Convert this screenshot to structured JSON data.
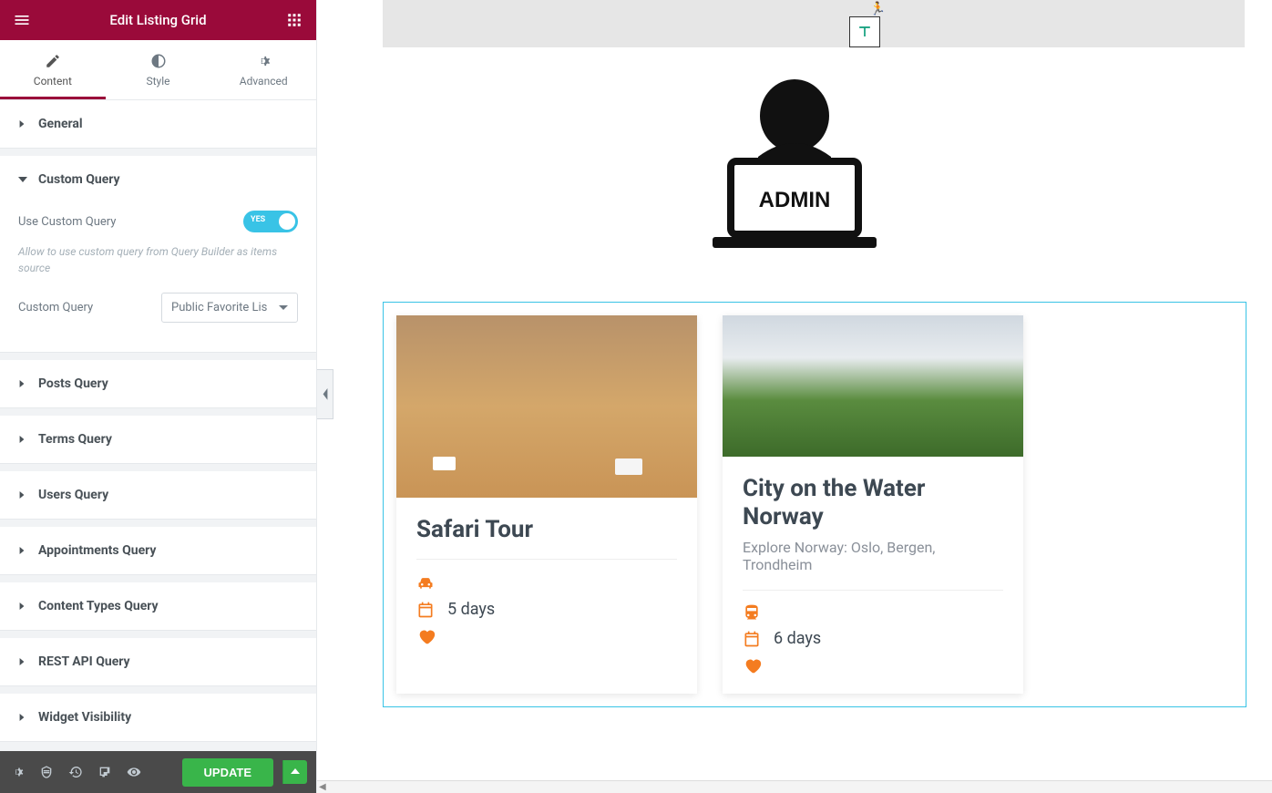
{
  "header": {
    "title": "Edit Listing Grid"
  },
  "tabs": {
    "content": "Content",
    "style": "Style",
    "advanced": "Advanced"
  },
  "sections": {
    "general": "General",
    "custom_query": "Custom Query",
    "posts_query": "Posts Query",
    "terms_query": "Terms Query",
    "users_query": "Users Query",
    "appointments_query": "Appointments Query",
    "content_types_query": "Content Types Query",
    "rest_api_query": "REST API Query",
    "widget_visibility": "Widget Visibility"
  },
  "custom_query": {
    "use_label": "Use Custom Query",
    "toggle_state": "YES",
    "description": "Allow to use custom query from Query Builder as items source",
    "select_label": "Custom Query",
    "select_value": "Public Favorite Lis"
  },
  "footer": {
    "update": "UPDATE"
  },
  "canvas": {
    "admin_label": "ADMIN",
    "cards": [
      {
        "title": "Safari Tour",
        "subtitle": "",
        "transport_icon": "car",
        "duration": "5 days"
      },
      {
        "title": "City on the Water Norway",
        "subtitle": "Explore Norway: Oslo, Bergen, Trondheim",
        "transport_icon": "train",
        "duration": "6 days"
      }
    ]
  }
}
